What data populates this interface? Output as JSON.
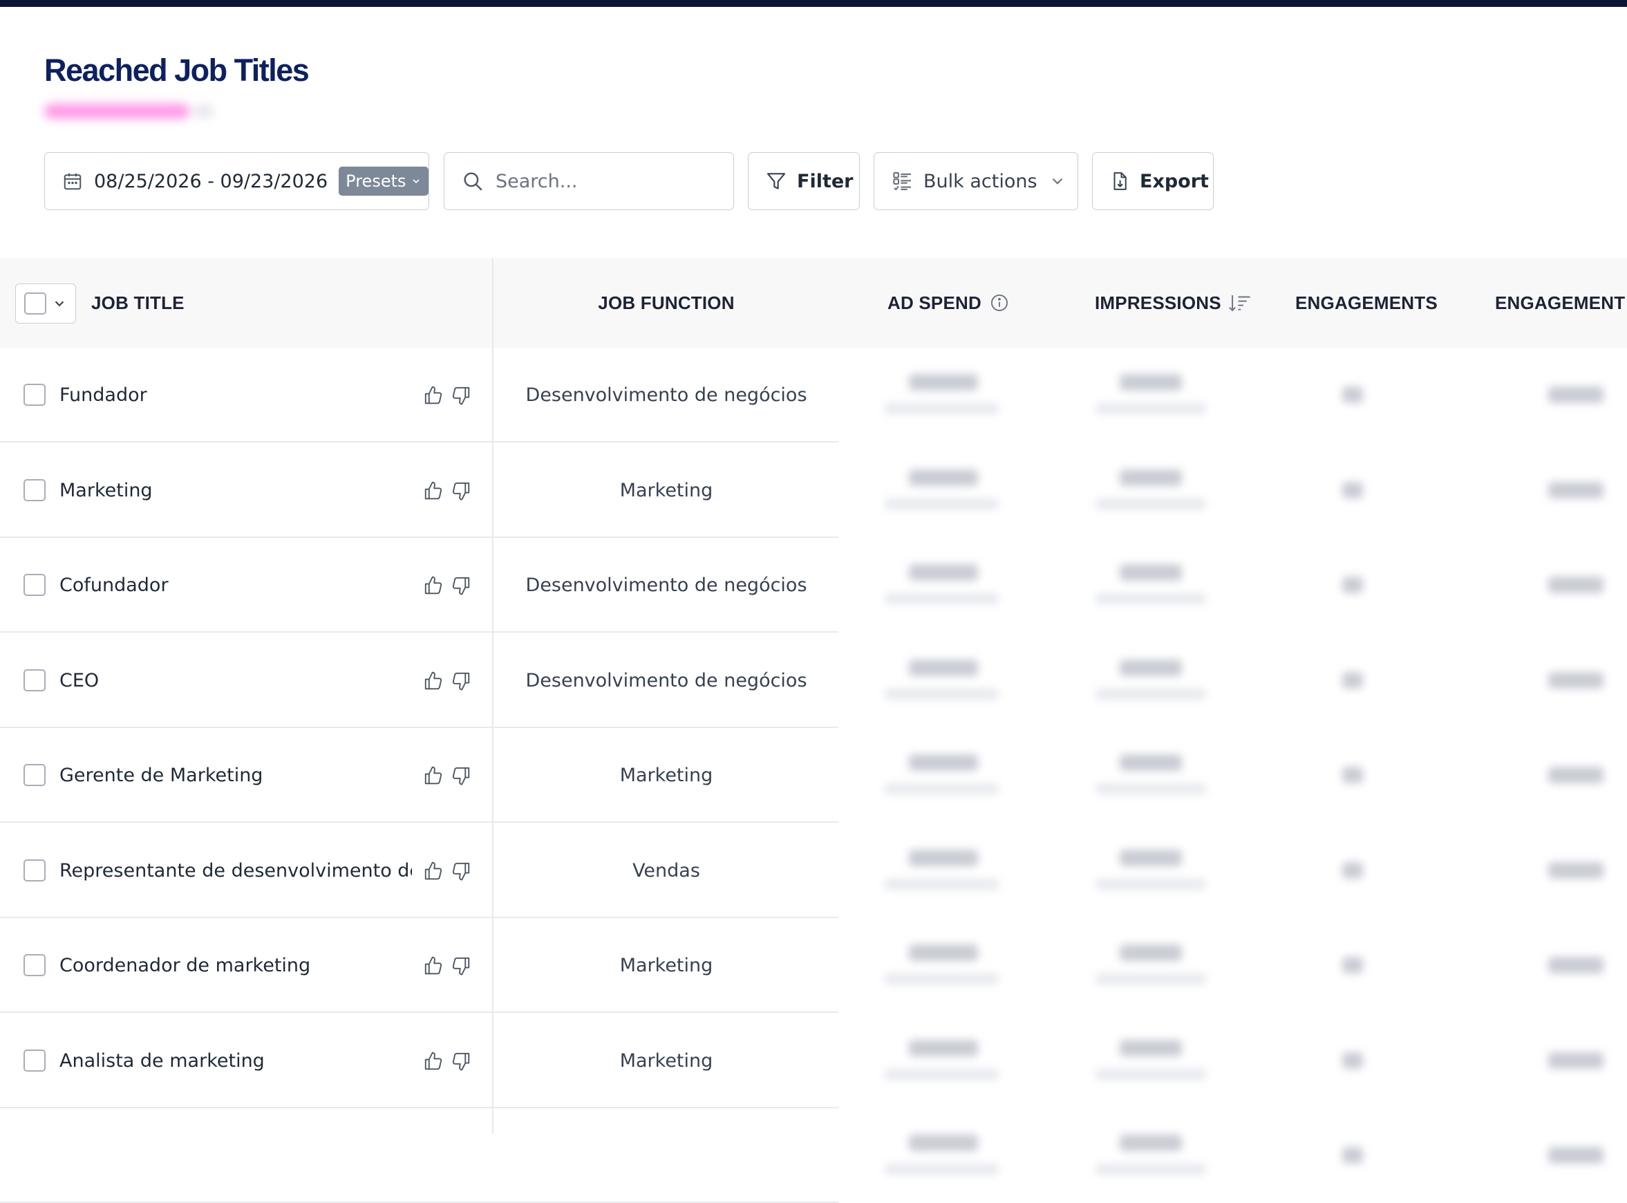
{
  "page": {
    "title": "Reached Job Titles"
  },
  "toolbar": {
    "date_range": "08/25/2026 - 09/23/2026",
    "presets_label": "Presets",
    "search_placeholder": "Search...",
    "filter_label": "Filter",
    "bulk_actions_label": "Bulk actions",
    "export_label": "Export"
  },
  "table": {
    "columns": {
      "job_title": "JOB TITLE",
      "job_function": "JOB FUNCTION",
      "ad_spend": "AD SPEND",
      "impressions": "IMPRESSIONS",
      "engagements": "ENGAGEMENTS",
      "engagement_rate": "ENGAGEMENT RA"
    },
    "rows": [
      {
        "title": "Fundador",
        "function": "Desenvolvimento de negócios"
      },
      {
        "title": "Marketing",
        "function": "Marketing"
      },
      {
        "title": "Cofundador",
        "function": "Desenvolvimento de negócios"
      },
      {
        "title": "CEO",
        "function": "Desenvolvimento de negócios"
      },
      {
        "title": "Gerente de Marketing",
        "function": "Marketing"
      },
      {
        "title": "Representante de desenvolvimento de v...",
        "function": "Vendas"
      },
      {
        "title": "Coordenador de marketing",
        "function": "Marketing"
      },
      {
        "title": "Analista de marketing",
        "function": "Marketing"
      }
    ]
  },
  "colors": {
    "title": "#0d2160",
    "topbar": "#0c1433",
    "presets_bg": "#7d8899",
    "header_bg": "#f8f8f9"
  }
}
